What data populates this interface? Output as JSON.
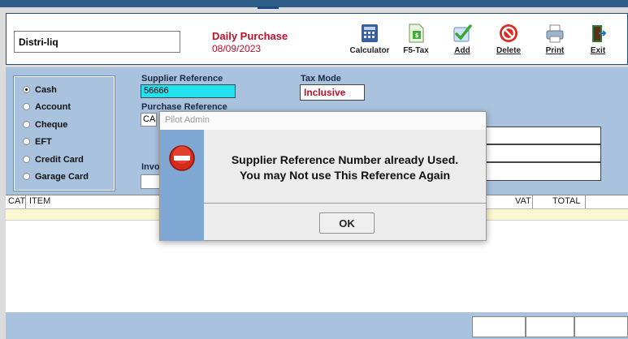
{
  "header": {
    "company": "Distri-liq",
    "title": "Daily Purchase",
    "date": "08/09/2023"
  },
  "toolbar": [
    {
      "label": "Calculator",
      "icon": "calculator-icon"
    },
    {
      "label": "F5-Tax",
      "icon": "tax-document-icon"
    },
    {
      "label": "Add",
      "icon": "add-checkmark-icon"
    },
    {
      "label": "Delete",
      "icon": "delete-no-icon"
    },
    {
      "label": "Print",
      "icon": "printer-icon"
    },
    {
      "label": "Exit",
      "icon": "exit-door-icon"
    }
  ],
  "payment_methods": [
    {
      "label": "Cash",
      "selected": true
    },
    {
      "label": "Account",
      "selected": false
    },
    {
      "label": "Cheque",
      "selected": false
    },
    {
      "label": "EFT",
      "selected": false
    },
    {
      "label": "Credit Card",
      "selected": false
    },
    {
      "label": "Garage Card",
      "selected": false
    }
  ],
  "form": {
    "supplier_reference_label": "Supplier Reference",
    "supplier_reference_value": "56666",
    "tax_mode_label": "Tax Mode",
    "tax_mode_value": "Inclusive",
    "purchase_reference_label": "Purchase Reference",
    "purchase_reference_value": "CA",
    "invoice_label": "Invoi"
  },
  "grid": {
    "columns": [
      "CAT",
      "ITEM",
      "VAT",
      "TOTAL"
    ]
  },
  "dialog": {
    "title": "Pilot Admin",
    "message_line1": "Supplier Reference Number already Used.",
    "message_line2": "You may Not use This Reference Again",
    "ok_label": "OK"
  },
  "colors": {
    "accent_red": "#c0102a",
    "panel_blue": "#a9c3df",
    "highlight_cyan": "#22e2f0"
  }
}
